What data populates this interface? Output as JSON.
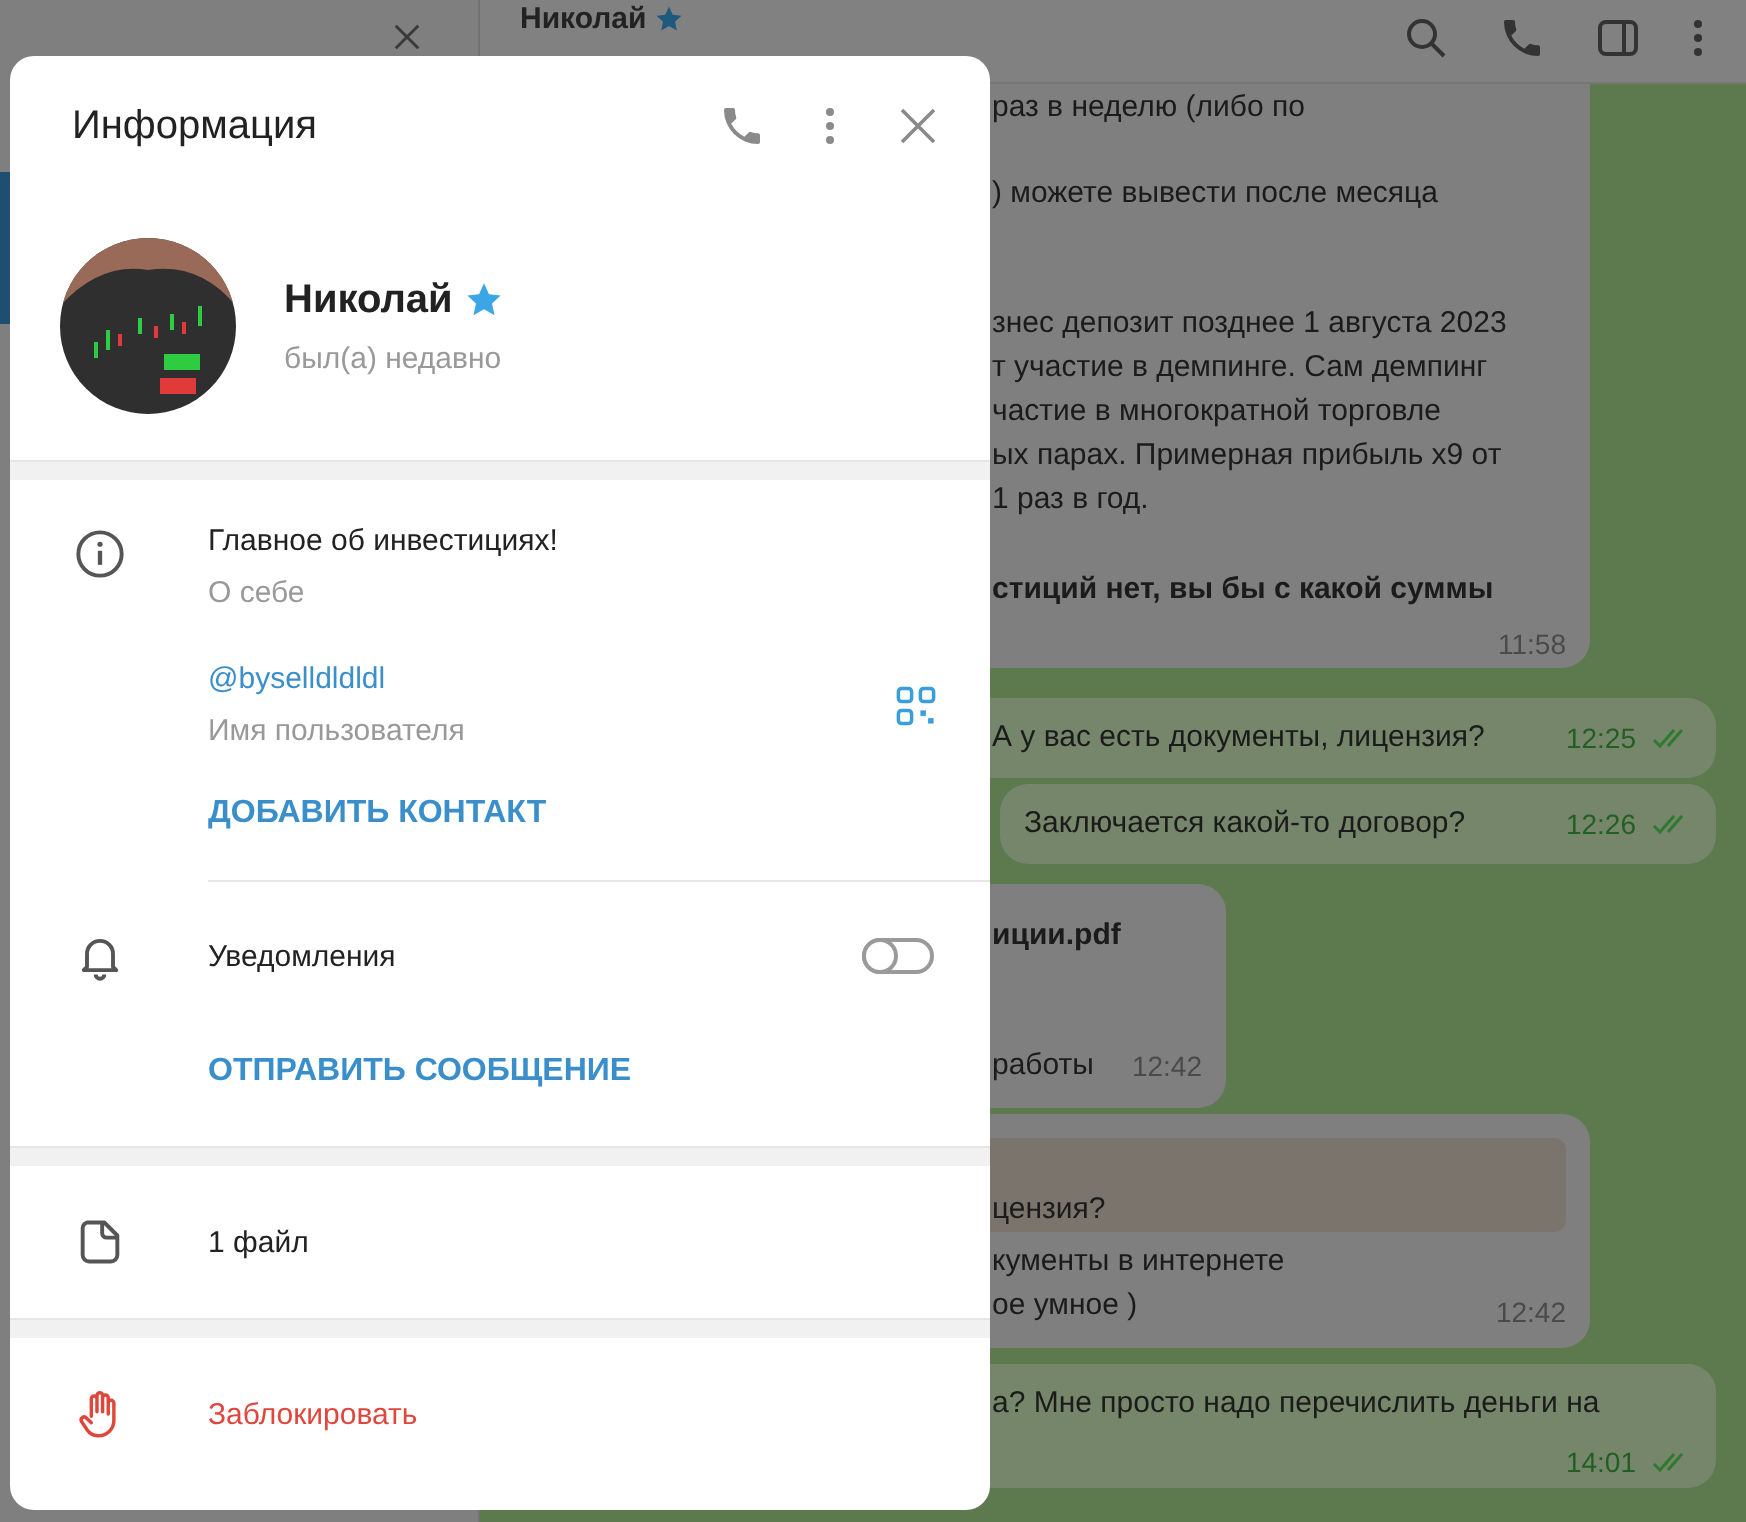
{
  "chat_header": {
    "name": "Николай"
  },
  "messages": [
    {
      "kind": "incoming",
      "paragraphs": [
        {
          "bold": false,
          "lines": [
            "раз в неделю (либо по"
          ]
        },
        {
          "bold": false,
          "lines": [
            ") можете вывести после месяца"
          ]
        },
        {
          "bold": false,
          "lines": [
            "знес депозит позднее 1 августа 2023",
            "т участие в демпинге. Сам демпинг",
            "частие в многократной  торговле",
            "ых парах. Примерная прибыль x9 от",
            "1 раз в год."
          ]
        },
        {
          "bold": true,
          "lines": [
            "стиций нет, вы бы с какой суммы"
          ]
        }
      ],
      "time": "11:58",
      "read": false
    },
    {
      "kind": "outgoing",
      "paragraphs": [
        {
          "bold": false,
          "lines": [
            "А у вас есть документы, лицензия?"
          ]
        }
      ],
      "time": "12:25",
      "read": true
    },
    {
      "kind": "outgoing",
      "paragraphs": [
        {
          "bold": false,
          "lines": [
            "Заключается какой-то договор?"
          ]
        }
      ],
      "time": "12:26",
      "read": true
    },
    {
      "kind": "file",
      "file": "иции.pdf",
      "paragraphs": [
        {
          "bold": false,
          "lines": [
            "работы"
          ]
        }
      ],
      "time": "12:42",
      "read": false
    },
    {
      "kind": "reply",
      "quote": "цензия?",
      "paragraphs": [
        {
          "bold": false,
          "lines": [
            "кументы в интернете",
            "ое умное )"
          ]
        }
      ],
      "time": "12:42",
      "read": false
    },
    {
      "kind": "outgoing",
      "paragraphs": [
        {
          "bold": false,
          "lines": [
            "а? Мне просто надо перечислить деньги на"
          ]
        }
      ],
      "time": "14:01",
      "read": true
    }
  ],
  "dialog": {
    "title": "Информация",
    "name": "Николай",
    "status": "был(а) недавно",
    "bio": "Главное об инвестициях!",
    "bio_label": "О себе",
    "username": "@byselldldldl",
    "username_label": "Имя пользователя",
    "add_contact": "ДОБАВИТЬ КОНТАКТ",
    "notifications": {
      "label": "Уведомления",
      "on": false
    },
    "send_message": "ОТПРАВИТЬ СООБЩЕНИЕ",
    "files": "1 файл",
    "block": "Заблокировать"
  }
}
